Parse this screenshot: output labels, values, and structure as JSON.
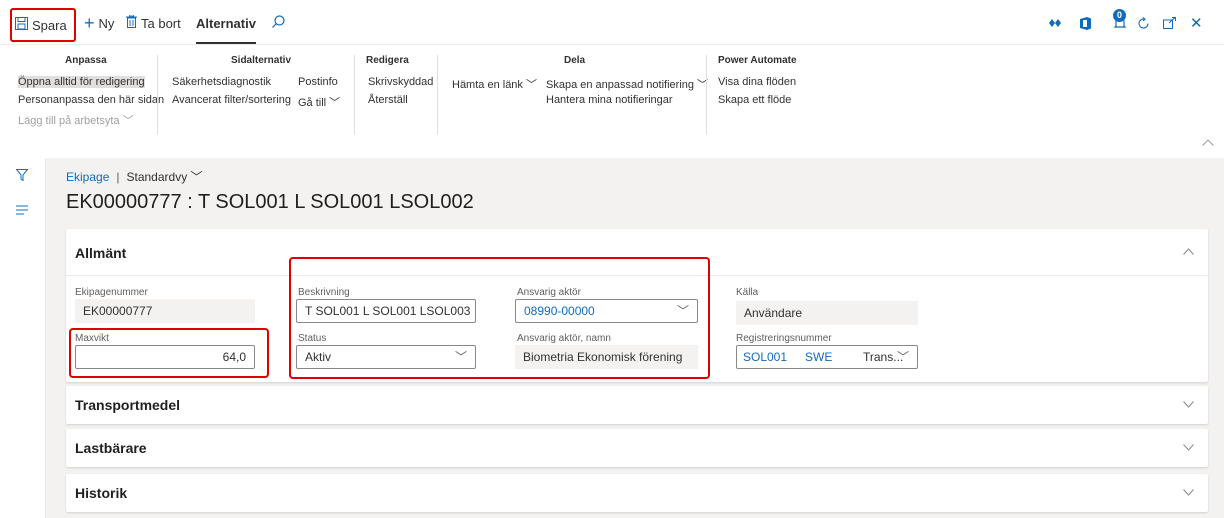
{
  "toolbar": {
    "save_label": "Spara",
    "new_label": "Ny",
    "delete_label": "Ta bort",
    "options_label": "Alternativ",
    "notification_count": "0"
  },
  "ribbon": {
    "groups": {
      "customize": {
        "title": "Anpassa",
        "items": [
          "Öppna alltid för redigering",
          "Personanpassa den här sidan",
          "Lägg till på arbetsyta ﹀"
        ]
      },
      "page_options": {
        "title": "Sidalternativ",
        "items": [
          "Säkerhetsdiagnostik",
          "Avancerat filter/sortering",
          "Postinfo",
          "Gå till ﹀"
        ]
      },
      "edit": {
        "title": "Redigera",
        "items": [
          "Skrivskyddad",
          "Återställ"
        ]
      },
      "share": {
        "title": "Dela",
        "items": [
          "Hämta en länk ﹀",
          "Skapa en anpassad notifiering ﹀",
          "Hantera mina notifieringar"
        ]
      },
      "power_automate": {
        "title": "Power Automate",
        "items": [
          "Visa dina flöden",
          "Skapa ett flöde"
        ]
      }
    }
  },
  "breadcrumb": {
    "link": "Ekipage",
    "view": "Standardvy ﹀"
  },
  "page_title": "EK00000777 : T SOL001 L SOL001 LSOL002",
  "sections": {
    "general": {
      "title": "Allmänt",
      "fields": {
        "ekipagenummer": {
          "label": "Ekipagenummer",
          "value": "EK00000777"
        },
        "maxvikt": {
          "label": "Maxvikt",
          "value": "64,0"
        },
        "beskrivning": {
          "label": "Beskrivning",
          "value": "T SOL001 L SOL001 LSOL003"
        },
        "status": {
          "label": "Status",
          "value": "Aktiv"
        },
        "ansvarig_aktor": {
          "label": "Ansvarig aktör",
          "value": "08990-00000"
        },
        "ansvarig_aktor_namn": {
          "label": "Ansvarig aktör, namn",
          "value": "Biometria Ekonomisk förening"
        },
        "kalla": {
          "label": "Källa",
          "value": "Användare"
        },
        "registreringsnummer": {
          "label": "Registreringsnummer",
          "reg": "SOL001",
          "country": "SWE",
          "type": "Trans..."
        }
      }
    },
    "transport": {
      "title": "Transportmedel"
    },
    "lastbarare": {
      "title": "Lastbärare"
    },
    "historik": {
      "title": "Historik"
    }
  },
  "colors": {
    "accent": "#0f6cbd",
    "highlight": "#e00000",
    "background": "#f3f2f1"
  }
}
